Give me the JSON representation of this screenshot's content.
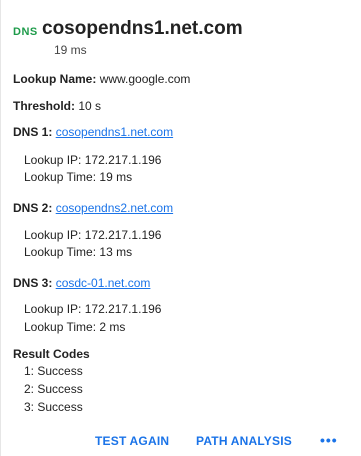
{
  "header": {
    "badge": "DNS",
    "title": "cosopendns1.net.com",
    "subtitle": "19 ms"
  },
  "lookup_name": {
    "label": "Lookup Name:",
    "value": "www.google.com"
  },
  "threshold": {
    "label": "Threshold:",
    "value": "10 s"
  },
  "dns_servers": [
    {
      "label": "DNS 1:",
      "server": "cosopendns1.net.com",
      "ip_label": "Lookup IP:",
      "ip": "172.217.1.196",
      "time_label": "Lookup Time:",
      "time": "19 ms"
    },
    {
      "label": "DNS 2:",
      "server": "cosopendns2.net.com",
      "ip_label": "Lookup IP:",
      "ip": "172.217.1.196",
      "time_label": "Lookup Time:",
      "time": "13 ms"
    },
    {
      "label": "DNS 3:",
      "server": "cosdc-01.net.com",
      "ip_label": "Lookup IP:",
      "ip": "172.217.1.196",
      "time_label": "Lookup Time:",
      "time": "2 ms"
    }
  ],
  "result_codes": {
    "title": "Result Codes",
    "items": [
      "1: Success",
      "2: Success",
      "3: Success"
    ]
  },
  "actions": {
    "test_again": "TEST AGAIN",
    "path_analysis": "PATH ANALYSIS",
    "more": "•••"
  },
  "colors": {
    "badge": "#1e9b4a",
    "link": "#1a73e8",
    "text": "#222222"
  }
}
